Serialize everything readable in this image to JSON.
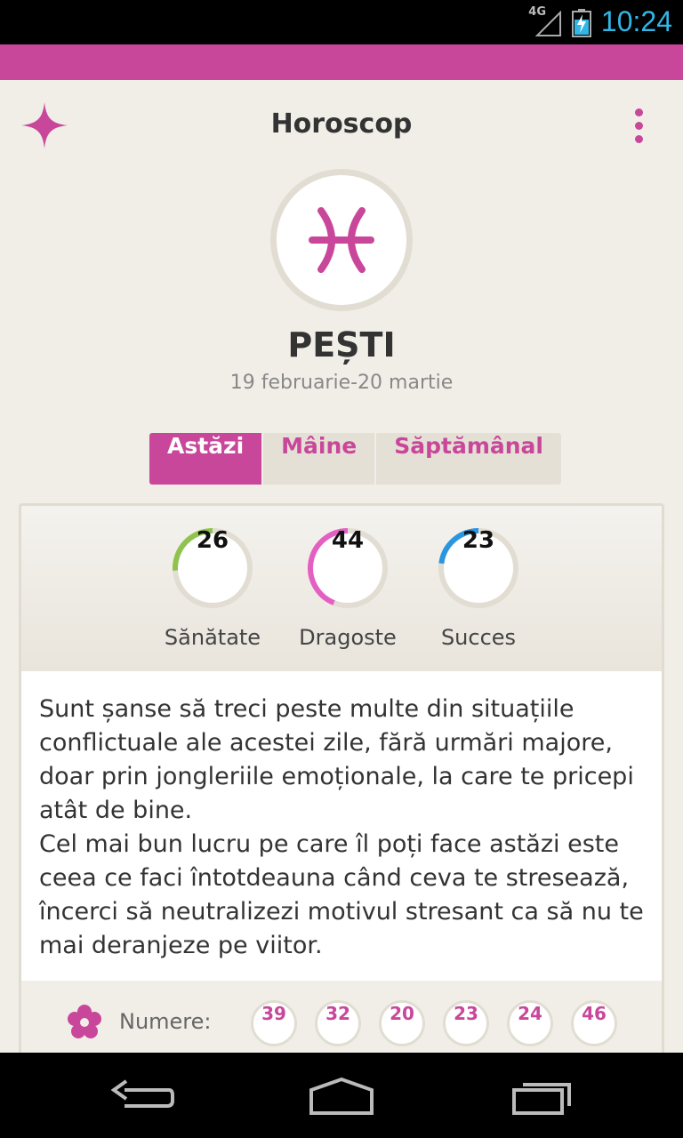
{
  "status_bar": {
    "network": "4G",
    "time": "10:24"
  },
  "header": {
    "title": "Horoscop"
  },
  "sign": {
    "name": "PEȘTI",
    "dates": "19 februarie-20 martie"
  },
  "tabs": [
    {
      "label": "Astăzi",
      "active": true
    },
    {
      "label": "Mâine",
      "active": false
    },
    {
      "label": "Săptămânal",
      "active": false
    }
  ],
  "meters": [
    {
      "label": "Sănătate",
      "value": "26",
      "color": "#8fc34e"
    },
    {
      "label": "Dragoste",
      "value": "44",
      "color": "#e45fc2"
    },
    {
      "label": "Succes",
      "value": "23",
      "color": "#2a96e0"
    }
  ],
  "horoscope_text": "Sunt șanse să treci peste multe din situațiile conflictuale ale acestei zile, fără urmări majore, doar prin jongleriile emoționale, la care te pricepi atât de bine.\nCel mai bun lucru pe care îl poți face astăzi este ceea ce faci întotdeauna când ceva te stresează, încerci să neutralizezi motivul stresant ca să nu te mai deranjeze pe viitor.",
  "numbers": {
    "label": "Numere:",
    "values": [
      "39",
      "32",
      "20",
      "23",
      "24",
      "46"
    ]
  },
  "colors": {
    "accent": "#c9479a",
    "background": "#f1eee8"
  },
  "icons": {
    "app": "sparkle-star-icon",
    "menu": "overflow-menu-icon",
    "sign": "pisces-icon",
    "numbers": "flower-icon"
  }
}
